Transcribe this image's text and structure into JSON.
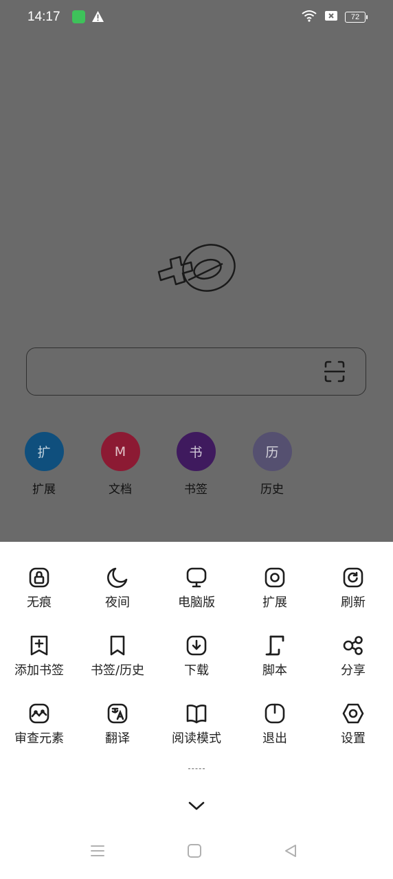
{
  "status_bar": {
    "time": "14:17",
    "battery": "72"
  },
  "quick_links": [
    {
      "glyph": "扩",
      "label": "扩展",
      "color": "#0f4f7d"
    },
    {
      "glyph": "M",
      "label": "文档",
      "color": "#8c1a33"
    },
    {
      "glyph": "书",
      "label": "书签",
      "color": "#3f1a5e"
    },
    {
      "glyph": "历",
      "label": "历史",
      "color": "#555070"
    }
  ],
  "menu": {
    "items": [
      {
        "label": "无痕",
        "icon": "incognito-lock-icon"
      },
      {
        "label": "夜间",
        "icon": "moon-icon"
      },
      {
        "label": "电脑版",
        "icon": "desktop-monitor-icon"
      },
      {
        "label": "扩展",
        "icon": "extension-icon"
      },
      {
        "label": "刷新",
        "icon": "refresh-icon"
      },
      {
        "label": "添加书签",
        "icon": "add-bookmark-icon"
      },
      {
        "label": "书签/历史",
        "icon": "bookmark-icon"
      },
      {
        "label": "下载",
        "icon": "download-icon"
      },
      {
        "label": "脚本",
        "icon": "script-icon"
      },
      {
        "label": "分享",
        "icon": "share-icon"
      },
      {
        "label": "审查元素",
        "icon": "inspect-element-icon"
      },
      {
        "label": "翻译",
        "icon": "translate-icon"
      },
      {
        "label": "阅读模式",
        "icon": "book-open-icon"
      },
      {
        "label": "退出",
        "icon": "power-icon"
      },
      {
        "label": "设置",
        "icon": "settings-hexagon-icon"
      }
    ]
  }
}
